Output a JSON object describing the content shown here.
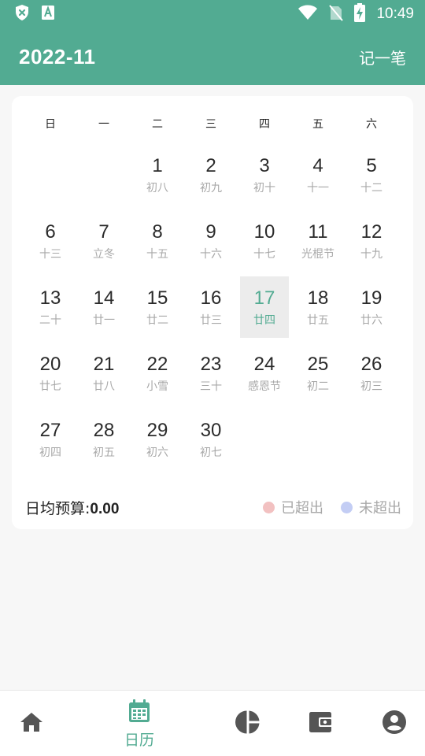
{
  "status_bar": {
    "time": "10:49",
    "icons": [
      "shield-x-icon",
      "text-a-icon",
      "wifi-icon",
      "no-sim-icon",
      "battery-charging-icon"
    ]
  },
  "header": {
    "title": "2022-11",
    "action_label": "记一笔"
  },
  "calendar": {
    "weekdays": [
      "日",
      "一",
      "二",
      "三",
      "四",
      "五",
      "六"
    ],
    "leading_blanks": 2,
    "selected_day": 17,
    "days": [
      {
        "num": "1",
        "lunar": "初八"
      },
      {
        "num": "2",
        "lunar": "初九"
      },
      {
        "num": "3",
        "lunar": "初十"
      },
      {
        "num": "4",
        "lunar": "十一"
      },
      {
        "num": "5",
        "lunar": "十二"
      },
      {
        "num": "6",
        "lunar": "十三"
      },
      {
        "num": "7",
        "lunar": "立冬"
      },
      {
        "num": "8",
        "lunar": "十五"
      },
      {
        "num": "9",
        "lunar": "十六"
      },
      {
        "num": "10",
        "lunar": "十七"
      },
      {
        "num": "11",
        "lunar": "光棍节"
      },
      {
        "num": "12",
        "lunar": "十九"
      },
      {
        "num": "13",
        "lunar": "二十"
      },
      {
        "num": "14",
        "lunar": "廿一"
      },
      {
        "num": "15",
        "lunar": "廿二"
      },
      {
        "num": "16",
        "lunar": "廿三"
      },
      {
        "num": "17",
        "lunar": "廿四"
      },
      {
        "num": "18",
        "lunar": "廿五"
      },
      {
        "num": "19",
        "lunar": "廿六"
      },
      {
        "num": "20",
        "lunar": "廿七"
      },
      {
        "num": "21",
        "lunar": "廿八"
      },
      {
        "num": "22",
        "lunar": "小雪"
      },
      {
        "num": "23",
        "lunar": "三十"
      },
      {
        "num": "24",
        "lunar": "感恩节"
      },
      {
        "num": "25",
        "lunar": "初二"
      },
      {
        "num": "26",
        "lunar": "初三"
      },
      {
        "num": "27",
        "lunar": "初四"
      },
      {
        "num": "28",
        "lunar": "初五"
      },
      {
        "num": "29",
        "lunar": "初六"
      },
      {
        "num": "30",
        "lunar": "初七"
      }
    ]
  },
  "summary": {
    "budget_label": "日均预算:",
    "budget_value": "0.00",
    "legend": [
      {
        "label": "已超出",
        "color": "#f2c1c1"
      },
      {
        "label": "未超出",
        "color": "#c3cdf4"
      }
    ]
  },
  "bottom_nav": {
    "items": [
      {
        "icon": "home-icon",
        "label": ""
      },
      {
        "icon": "calendar-icon",
        "label": "日历"
      },
      {
        "icon": "pie-chart-icon",
        "label": ""
      },
      {
        "icon": "wallet-icon",
        "label": ""
      },
      {
        "icon": "account-icon",
        "label": ""
      }
    ],
    "active_index": 1
  },
  "colors": {
    "primary": "#52ab92",
    "selected_bg": "#ececec",
    "muted_text": "#a8a8a8",
    "nav_icon": "#555555"
  }
}
